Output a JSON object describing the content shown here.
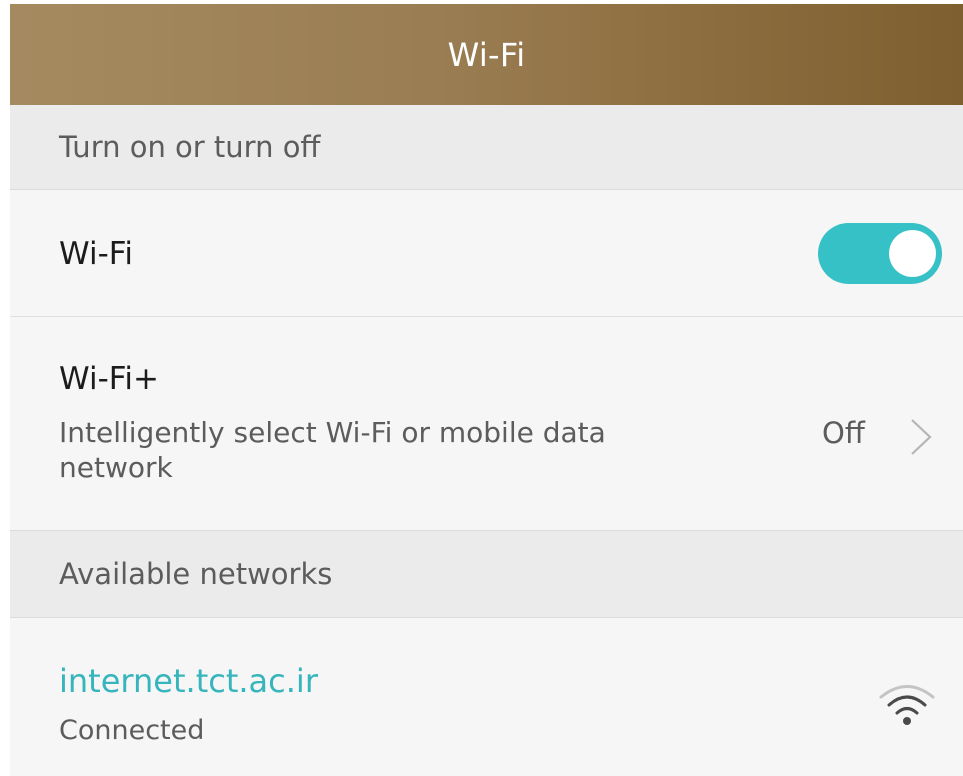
{
  "header": {
    "title": "Wi-Fi"
  },
  "sections": {
    "toggle_header": "Turn on or turn off",
    "available_header": "Available networks"
  },
  "wifi_row": {
    "label": "Wi-Fi",
    "enabled": true
  },
  "wifi_plus_row": {
    "label": "Wi-Fi+",
    "description": "Intelligently select Wi-Fi or mobile data network",
    "status": "Off",
    "chevron_icon": "chevron-right-icon"
  },
  "networks": [
    {
      "ssid": "internet.tct.ac.ir",
      "status": "Connected",
      "signal_icon": "wifi-signal-icon"
    }
  ],
  "colors": {
    "accent": "#36c1c6",
    "ssid_connected": "#36b5bd",
    "titlebar_start": "#a58a60",
    "titlebar_end": "#7e5f30"
  }
}
